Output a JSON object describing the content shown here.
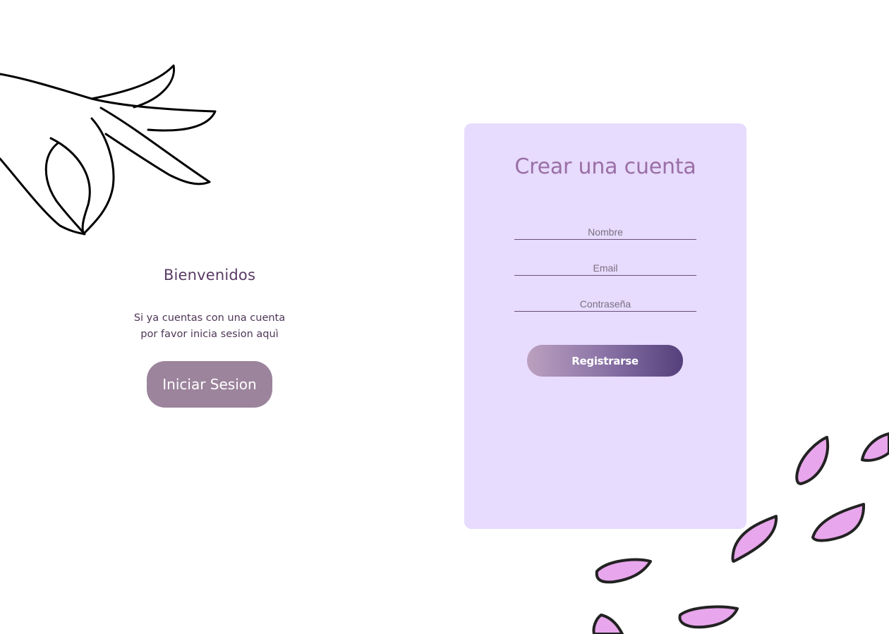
{
  "welcome": {
    "title": "Bienvenidos",
    "line1": "Si ya cuentas con una cuenta",
    "line2": "por favor inicia sesion aquì",
    "login_label": "Iniciar Sesion"
  },
  "register": {
    "title": "Crear una cuenta",
    "name_placeholder": "Nombre",
    "email_placeholder": "Email",
    "password_placeholder": "Contraseña",
    "submit_label": "Registrarse"
  },
  "colors": {
    "card_bg": "#e7dbfe",
    "title": "#9a6fa5",
    "login_button": "#9b849c",
    "petal": "#e8a6ec",
    "gradient_start": "#bba0bf",
    "gradient_end": "#55407c"
  },
  "illustrations": {
    "hand": "hand-line-art-icon",
    "petals": "petals-icon"
  }
}
